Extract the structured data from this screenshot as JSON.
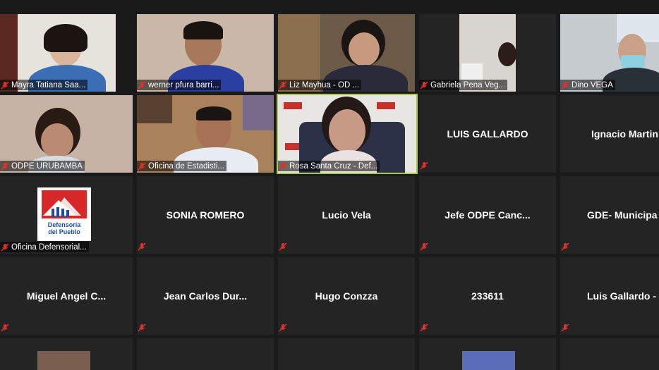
{
  "participants": [
    {
      "name": "Mayra Tatiana Saa...",
      "muted": true
    },
    {
      "name": "werner pfura barri...",
      "muted": true
    },
    {
      "name": "Liz  Mayhua  - OD ...",
      "muted": true
    },
    {
      "name": "Gabriela Pena Veg...",
      "muted": true
    },
    {
      "name": "Dino VEGA",
      "muted": true
    },
    {
      "name": "ODPE URUBAMBA",
      "muted": true
    },
    {
      "name": "Oficina de Estadisti...",
      "muted": true
    },
    {
      "name": "Rosa Santa Cruz - Def...",
      "muted": true,
      "active_speaker": true
    },
    {
      "name": "LUIS GALLARDO",
      "muted": true
    },
    {
      "name": "Ignacio Martin",
      "muted": true
    },
    {
      "name": "Oficina Defensorial...",
      "muted": true
    },
    {
      "name": "SONIA ROMERO",
      "muted": true
    },
    {
      "name": "Lucio Vela",
      "muted": true
    },
    {
      "name": "Jefe ODPE Canc...",
      "muted": true
    },
    {
      "name": "GDE-  Municipa",
      "muted": true
    },
    {
      "name": "Miguel Angel C...",
      "muted": true
    },
    {
      "name": "Jean Carlos Dur...",
      "muted": true
    },
    {
      "name": "Hugo Conzza",
      "muted": true
    },
    {
      "name": "233611",
      "muted": true
    },
    {
      "name": "Luis Gallardo -",
      "muted": true
    }
  ],
  "logo_text": {
    "line1": "Defensoría",
    "line2": "del Pueblo"
  },
  "colors": {
    "background": "#1a1a1a",
    "tile": "#242424",
    "active_border": "#a8c84a",
    "muted_icon": "#e0302a"
  }
}
